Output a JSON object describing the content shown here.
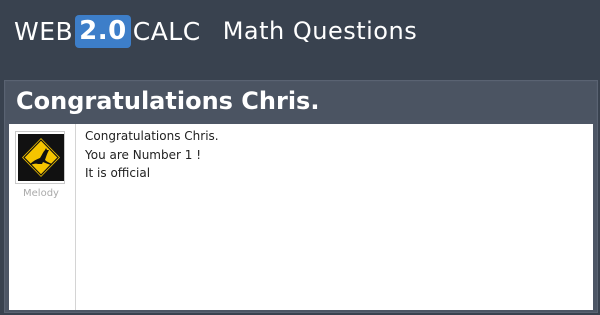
{
  "header": {
    "logo_web": "WEB",
    "logo_version": "2.0",
    "logo_calc": "CALC",
    "section": "Math Questions"
  },
  "question": {
    "title": "Congratulations Chris.",
    "author": "Melody",
    "body_lines": [
      "Congratulations Chris.",
      "You are Number 1 !",
      "It is official"
    ]
  },
  "colors": {
    "background": "#39424f",
    "accent": "#3d7ec9"
  },
  "icons": {
    "avatar": "kangaroo-road-sign-icon"
  }
}
